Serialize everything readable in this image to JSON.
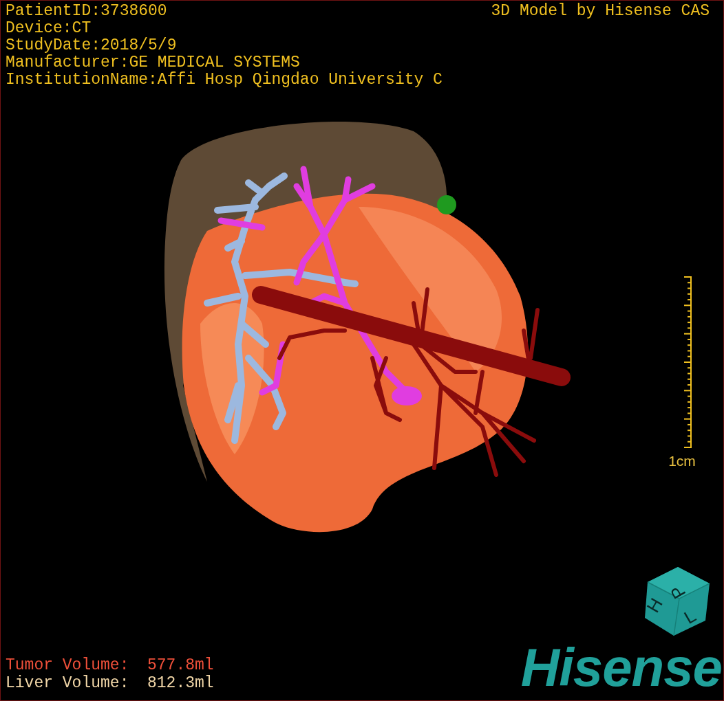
{
  "patient_info": [
    "PatientID:3738600",
    "Device:CT",
    "StudyDate:2018/5/9",
    "Manufacturer:GE MEDICAL SYSTEMS",
    "InstitutionName:Affi Hosp Qingdao University C"
  ],
  "title": "3D Model by Hisense CAS",
  "scale_bar": {
    "label": "1cm"
  },
  "orientation_cube": {
    "faces": [
      "H",
      "P",
      "L"
    ]
  },
  "volumes": [
    {
      "label": "Tumor Volume:",
      "value": "577.8ml",
      "color": "#f0503a"
    },
    {
      "label": "Liver Volume:",
      "value": "812.3ml",
      "color": "#f2d7a8"
    }
  ],
  "logo": {
    "text": "Hisense"
  }
}
